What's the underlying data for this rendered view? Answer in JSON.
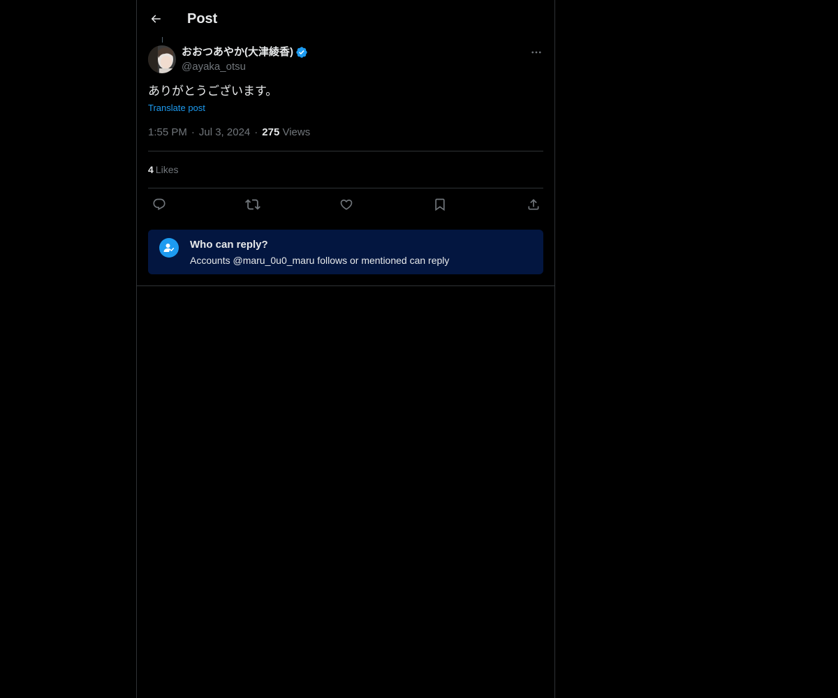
{
  "header": {
    "title": "Post",
    "back_icon": "arrow-left-icon"
  },
  "post": {
    "author": {
      "display_name": "おおつあやか(大津綾香)",
      "handle": "@ayaka_otsu",
      "verified": true,
      "verified_color": "#1d9bf0"
    },
    "text": "ありがとうございます。",
    "translate_label": "Translate post",
    "time": "1:55 PM",
    "date": "Jul 3, 2024",
    "views_count": "275",
    "views_label": "Views",
    "likes_count": "4",
    "likes_label": "Likes"
  },
  "actions": [
    {
      "name": "reply",
      "icon": "comment-icon"
    },
    {
      "name": "repost",
      "icon": "repost-icon"
    },
    {
      "name": "like",
      "icon": "heart-icon"
    },
    {
      "name": "bookmark",
      "icon": "bookmark-icon"
    },
    {
      "name": "share",
      "icon": "share-icon"
    }
  ],
  "reply_restriction": {
    "title": "Who can reply?",
    "description": "Accounts @maru_0u0_maru follows or mentioned can reply",
    "background_color": "#031640",
    "icon_color": "#1d9bf0"
  },
  "colors": {
    "background": "#000000",
    "text_primary": "#e7e9ea",
    "text_secondary": "#71767b",
    "accent": "#1d9bf0",
    "border": "#2f3336"
  }
}
